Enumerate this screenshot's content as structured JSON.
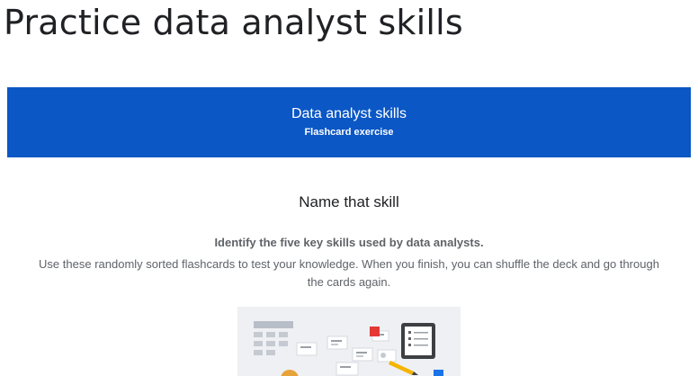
{
  "page": {
    "title": "Practice data analyst skills"
  },
  "banner": {
    "title": "Data analyst skills",
    "subtitle": "Flashcard exercise"
  },
  "section": {
    "heading": "Name that skill",
    "intro_bold": "Identify the five key skills used by data analysts.",
    "intro_body": "Use these randomly sorted flashcards to test your knowledge. When you finish, you can shuffle the deck and go through the cards again."
  },
  "colors": {
    "banner_bg": "#0b57c5",
    "illustration_bg": "#eef0f3",
    "accent_red": "#e53935",
    "accent_yellow": "#f4b400",
    "accent_blue": "#1a73e8"
  },
  "icons": [
    "flashcard-illustration",
    "tablet-checklist-icon",
    "pencil-icon",
    "sticky-note-icon"
  ]
}
